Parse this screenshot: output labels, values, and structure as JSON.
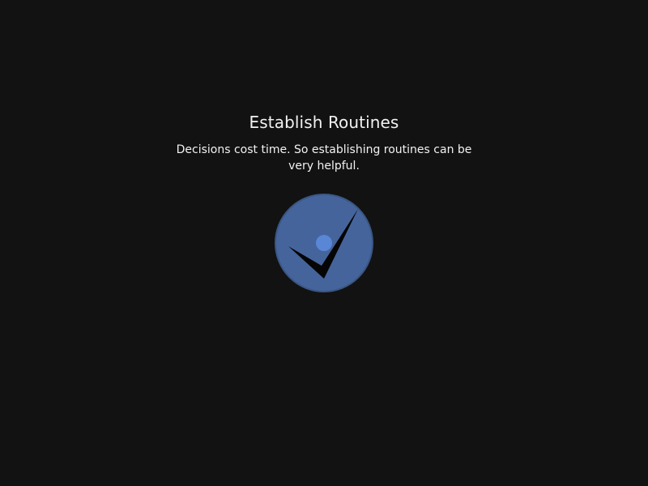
{
  "card": {
    "title": "Establish Routines",
    "description": "Decisions cost time. So establishing routines can be very helpful."
  },
  "icon": {
    "name": "checkmark-icon",
    "circle_color": "#45649c",
    "circle_border_color": "#3a5684",
    "dot_color": "#5a86d6",
    "check_color": "#050505"
  }
}
